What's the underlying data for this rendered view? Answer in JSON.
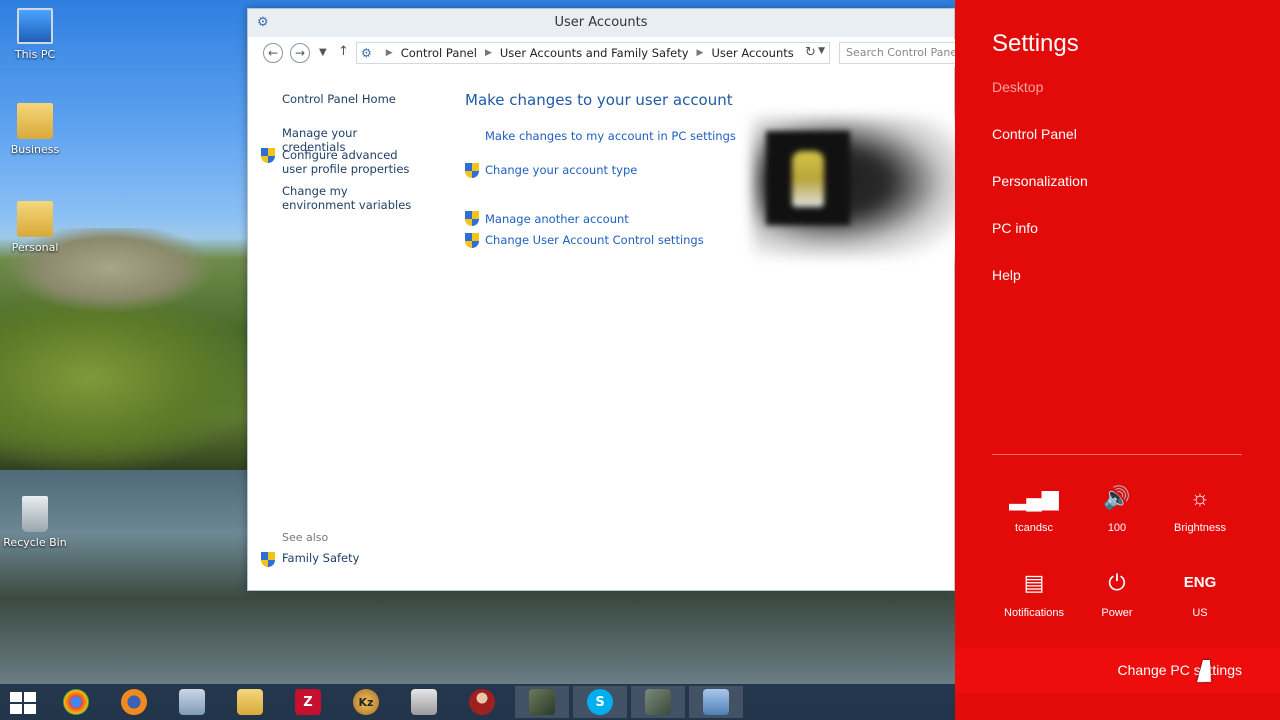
{
  "desktop": {
    "icons": [
      {
        "label": "This PC"
      },
      {
        "label": "Business"
      },
      {
        "label": "Personal"
      },
      {
        "label": "Recycle Bin"
      }
    ]
  },
  "window": {
    "title": "User Accounts",
    "breadcrumbs": [
      "Control Panel",
      "User Accounts and Family Safety",
      "User Accounts"
    ],
    "search_placeholder": "Search Control Panel",
    "left_links": [
      {
        "label": "Control Panel Home"
      },
      {
        "label": "Manage your credentials"
      },
      {
        "label": "Configure advanced user profile properties"
      },
      {
        "label": "Change my environment variables"
      }
    ],
    "see_also": "See also",
    "family_safety": "Family Safety",
    "main_title": "Make changes to your user account",
    "main_links": [
      {
        "label": "Make changes to my account in PC settings"
      },
      {
        "label": "Change your account type"
      },
      {
        "label": "Manage another account"
      },
      {
        "label": "Change User Account Control settings"
      }
    ]
  },
  "charm": {
    "title": "Settings",
    "items": [
      {
        "label": "Desktop"
      },
      {
        "label": "Control Panel"
      },
      {
        "label": "Personalization"
      },
      {
        "label": "PC info"
      },
      {
        "label": "Help"
      }
    ],
    "tiles": [
      {
        "label": "tcandsc",
        "icon": "wifi-signal-icon"
      },
      {
        "label": "100",
        "icon": "volume-icon"
      },
      {
        "label": "Brightness",
        "icon": "brightness-icon"
      },
      {
        "label": "Notifications",
        "icon": "notifications-icon"
      },
      {
        "label": "Power",
        "icon": "power-icon"
      },
      {
        "label": "US",
        "icon_text": "ENG"
      }
    ],
    "change_pc_settings": "Change PC settings",
    "accent": "#e30a0a"
  },
  "taskbar": {
    "apps": [
      "start",
      "chrome",
      "firefox",
      "explorer",
      "file-manager",
      "filezilla",
      "kz",
      "notepad",
      "agent",
      "terminal",
      "skype",
      "recorder",
      "control-panel"
    ]
  }
}
